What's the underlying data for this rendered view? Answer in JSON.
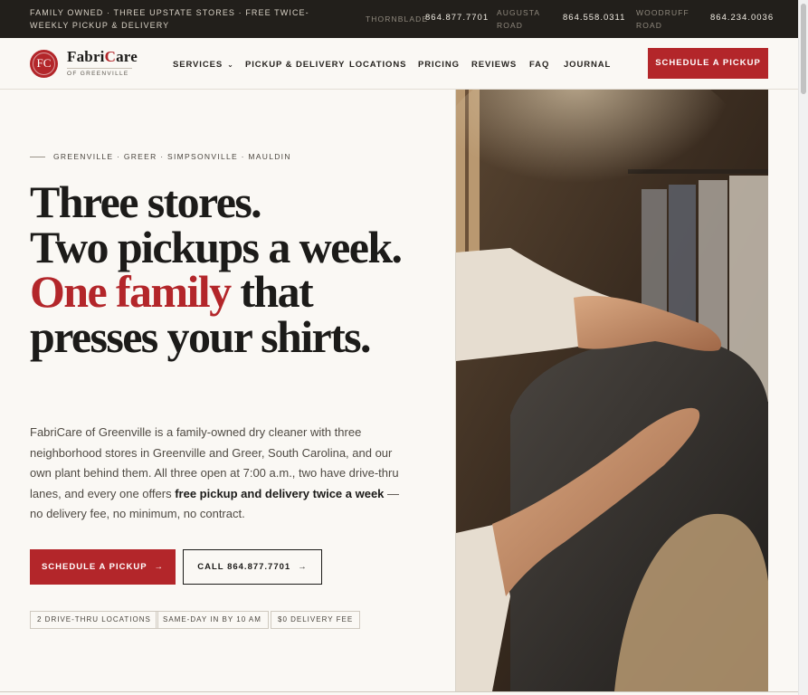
{
  "topbar": {
    "tagline": "FAMILY OWNED · THREE UPSTATE STORES · FREE TWICE-WEEKLY PICKUP & DELIVERY",
    "locations": [
      {
        "name": "THORNBLADE",
        "phone": "864.877.7701"
      },
      {
        "name": "AUGUSTA ROAD",
        "phone": "864.558.0311"
      },
      {
        "name": "WOODRUFF ROAD",
        "phone": "864.234.0036"
      }
    ]
  },
  "brand": {
    "mark": "FC",
    "name_part1": "Fabri",
    "name_part2": "C",
    "name_part3": "are",
    "sub": "OF GREENVILLE"
  },
  "nav": {
    "items": [
      "SERVICES",
      "PICKUP & DELIVERY",
      "LOCATIONS",
      "PRICING",
      "REVIEWS",
      "FAQ",
      "JOURNAL"
    ],
    "cta": "SCHEDULE A PICKUP"
  },
  "hero": {
    "eyebrow": "GREENVILLE · GREER · SIMPSONVILLE · MAULDIN",
    "headline_line1": "Three stores.",
    "headline_line2": "Two pickups a week.",
    "headline_red": "One family",
    "headline_line3": " that presses your shirts.",
    "lede_before": "FabriCare of Greenville is a family-owned dry cleaner with three neighborhood stores in Greenville and Greer, South Carolina, and our own plant behind them. All three open at 7:00 a.m., two have drive-thru lanes, and every one offers ",
    "lede_strong": "free pickup and delivery twice a week",
    "lede_after": " — no delivery fee, no minimum, no contract.",
    "primary_button": "SCHEDULE A PICKUP",
    "secondary_button": "CALL 864.877.7701",
    "arrow": "→",
    "chips": [
      "2 DRIVE-THRU LOCATIONS",
      "SAME-DAY IN BY 10 AM",
      "$0 DELIVERY FEE"
    ]
  },
  "colors": {
    "accent": "#b3262a",
    "dark": "#221f1b",
    "background": "#faf8f4"
  }
}
